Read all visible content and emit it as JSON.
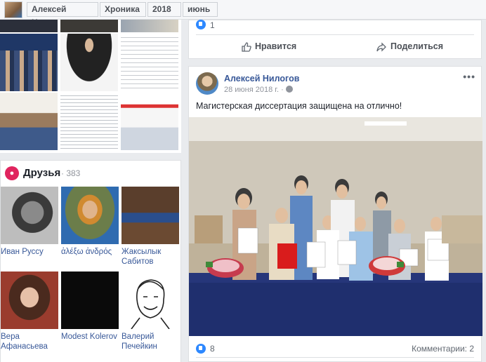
{
  "topbar": {
    "profile_name": "Алексей Нилогов",
    "section": "Хроника",
    "year": "2018",
    "month": "июнь"
  },
  "friends": {
    "title": "Друзья",
    "count": "· 383",
    "items": [
      {
        "name": "Иван Руссу"
      },
      {
        "name": "ἀλέξω ἀνδρός"
      },
      {
        "name": "Жаксылык Сабитов"
      },
      {
        "name": "Вера Афанасьева"
      },
      {
        "name": "Modest Kolerov"
      },
      {
        "name": "Валерий Печейкин"
      }
    ]
  },
  "previous_post": {
    "likes": "1",
    "like_label": "Нравится",
    "share_label": "Поделиться"
  },
  "post": {
    "author": "Алексей Нилогов",
    "date": "28 июня 2018 г. ·",
    "text": "Магистерская диссертация защищена на отлично!",
    "likes": "8",
    "comments": "Комментарии: 2"
  },
  "icons": {
    "friends": "friends-icon",
    "like": "thumbs-up-icon",
    "share": "share-arrow-icon",
    "privacy": "globe-icon",
    "more": "more-options-icon"
  },
  "colors": {
    "link": "#385898",
    "like_blue": "#2d88ff",
    "friends_badge": "#e0245e",
    "page_bg": "#e9ebee"
  }
}
